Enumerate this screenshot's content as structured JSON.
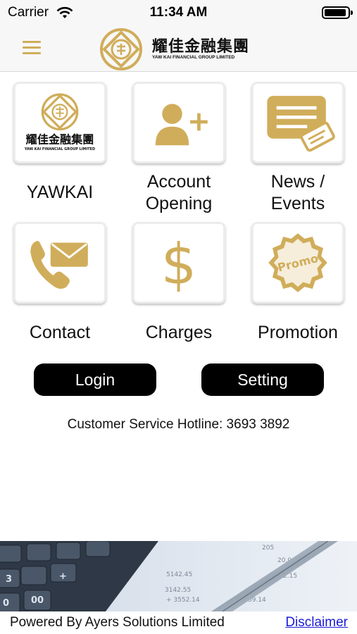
{
  "status_bar": {
    "carrier": "Carrier",
    "time": "11:34 AM"
  },
  "header": {
    "brand_cn": "耀佳金融集團",
    "brand_en": "YAW KAI FINANCIAL GROUP LIMITED"
  },
  "menu": {
    "tiles": [
      {
        "label": "YAWKAI",
        "icon": "yawkai-logo-icon"
      },
      {
        "label": "Account\nOpening",
        "icon": "add-user-icon"
      },
      {
        "label": "News /\nEvents",
        "icon": "news-ticket-icon"
      },
      {
        "label": "Contact",
        "icon": "phone-mail-icon"
      },
      {
        "label": "Charges",
        "icon": "dollar-icon"
      },
      {
        "label": "Promotion",
        "icon": "promo-badge-icon"
      }
    ],
    "yawkai_tile": {
      "cn": "耀佳金融集團",
      "en": "YAW KAI FINANCIAL GROUP LIMITED"
    },
    "promo_text": "Promo"
  },
  "actions": {
    "login_label": "Login",
    "setting_label": "Setting"
  },
  "hotline": "Customer Service Hotline: 3693 3892",
  "footer": {
    "powered_by": "Powered By Ayers Solutions Limited",
    "disclaimer": "Disclaimer"
  },
  "colors": {
    "gold": "#d0ad5a",
    "button_bg": "#000000",
    "link": "#1a1ad8"
  }
}
